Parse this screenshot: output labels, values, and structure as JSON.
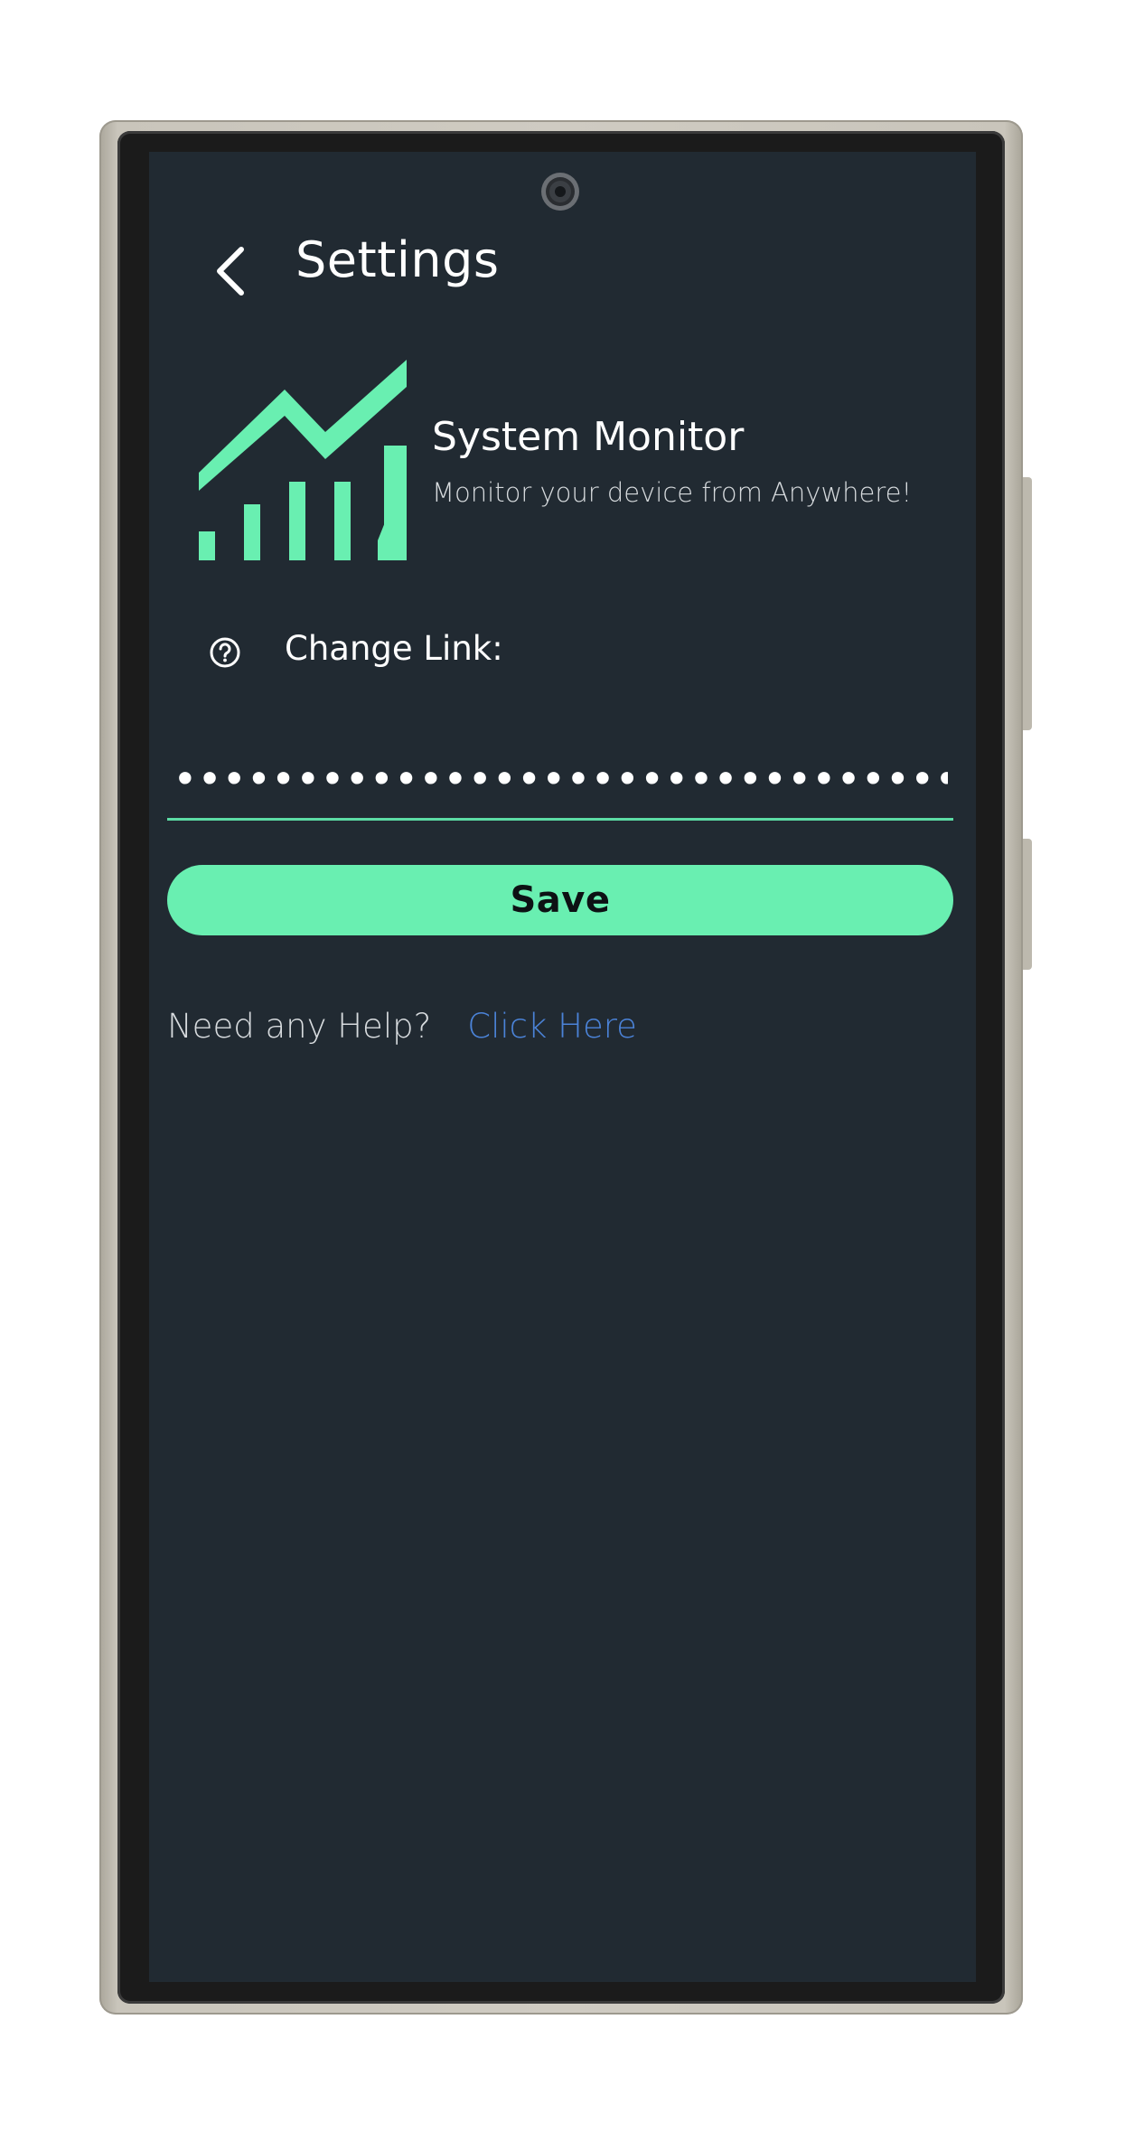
{
  "header": {
    "title": "Settings",
    "back_icon": "chevron-left-icon"
  },
  "app_info": {
    "name": "System Monitor",
    "tagline": "Monitor your device from Anywhere!",
    "logo_icon": "chart-growth-icon",
    "logo_color": "#69efb1"
  },
  "change_link": {
    "label": "Change Link:",
    "help_icon": "question-circle-icon",
    "input_value": "••••••••••••••••••••••••••••••••••••••••••••••••••••••••••••••••",
    "input_type": "password",
    "underline_color": "#5cdca5"
  },
  "save_button": {
    "label": "Save",
    "color": "#69efb1"
  },
  "help": {
    "prompt": "Need any Help?",
    "link_label": "Click Here",
    "link_color": "#4b83d8"
  },
  "theme": {
    "background": "#212a32",
    "text": "#ffffff"
  }
}
